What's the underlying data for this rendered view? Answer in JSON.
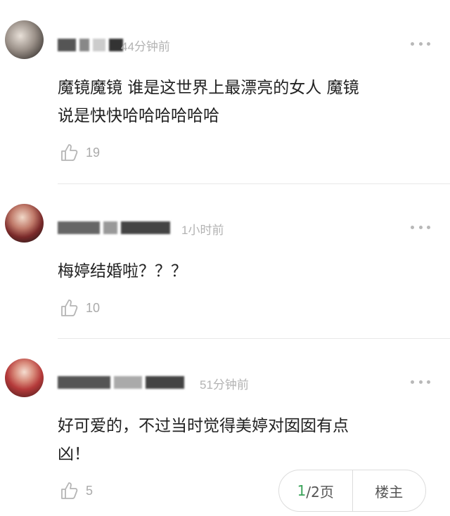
{
  "comments": [
    {
      "time": "44分钟前",
      "text_lines": [
        "魔镜魔镜 谁是这世界上最漂亮的女人 魔镜",
        "说是快快哈哈哈哈哈哈"
      ],
      "likes": "19"
    },
    {
      "time": "1小时前",
      "text_lines": [
        "梅婷结婚啦？？？"
      ],
      "likes": "10"
    },
    {
      "time": "51分钟前",
      "text_lines": [
        "好可爱的，不过当时觉得美婷对囡囡有点",
        "凶！"
      ],
      "likes": "5"
    }
  ],
  "pager": {
    "current": "1",
    "total": "/2页",
    "op_label": "楼主"
  },
  "icons": {
    "more": "more-dots-icon",
    "like": "thumbs-up-icon"
  }
}
